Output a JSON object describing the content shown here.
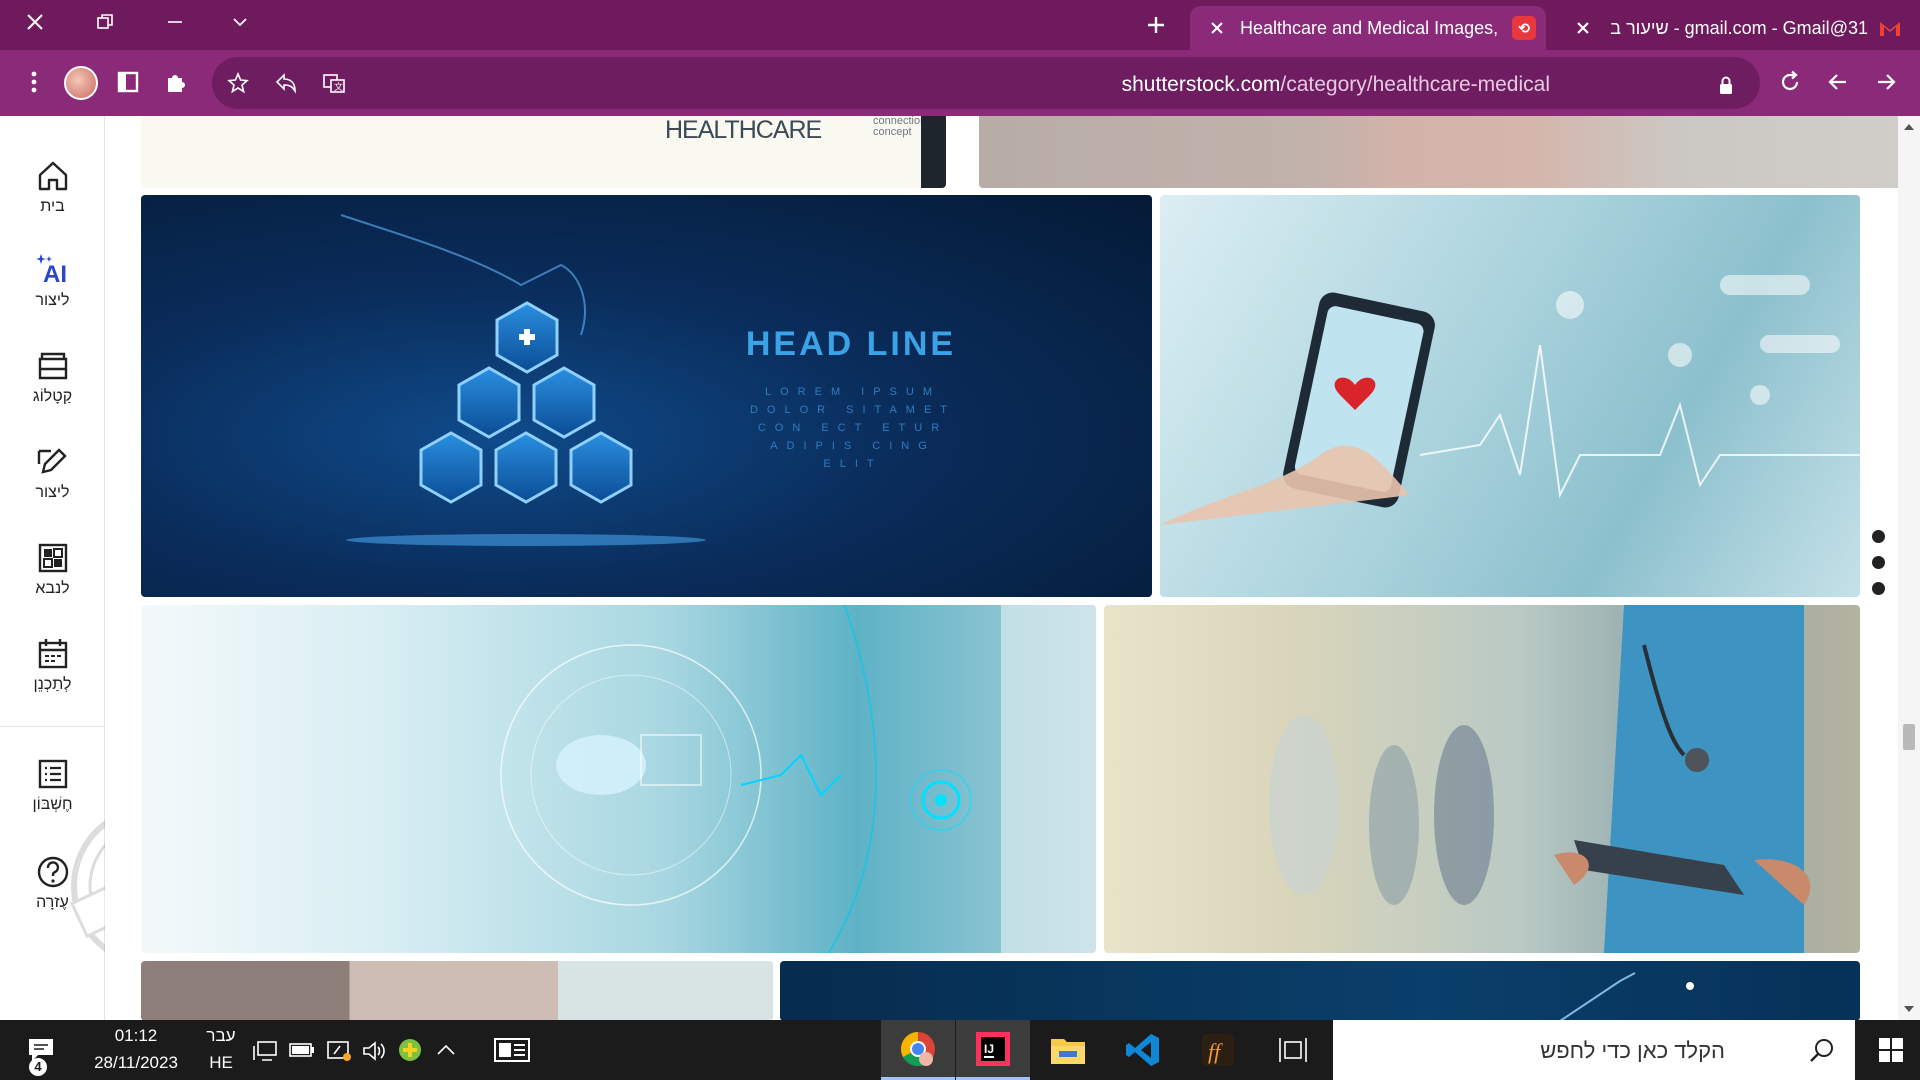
{
  "browser": {
    "tabs": [
      {
        "title": "Healthcare and Medical Images,",
        "favicon": "shutterstock-icon",
        "active": true
      },
      {
        "title": "31@gmail.com - Gmail - שיעור ב",
        "favicon": "gmail-icon",
        "active": false
      }
    ],
    "new_tab_label": "+",
    "url_host": "shutterstock.com",
    "url_path": "/category/healthcare-medical"
  },
  "rail": {
    "items": [
      {
        "label": "בית",
        "icon": "home-icon"
      },
      {
        "label": "ליצור",
        "icon": "ai-create-icon"
      },
      {
        "label": "קַטָלוֹג",
        "icon": "catalog-icon"
      },
      {
        "label": "ליצור",
        "icon": "edit-icon"
      },
      {
        "label": "לנבא",
        "icon": "predict-icon"
      },
      {
        "label": "לְתַכְנֵן",
        "icon": "calendar-icon"
      },
      {
        "label": "חֶשְׁבּוֹן",
        "icon": "account-icon"
      },
      {
        "label": "עֶזרָה",
        "icon": "help-icon"
      }
    ]
  },
  "images": {
    "top_left_caption_main": "HEALTHCARE",
    "top_left_caption_sub1": "connection",
    "top_left_caption_sub2": "concept",
    "headline_title": "HEAD LINE",
    "headline_body": [
      "LOREM IPSUM",
      "DOLOR SITAMET",
      "CON ECT ETUR",
      "ADIPIS CING",
      "ELIT"
    ]
  },
  "taskbar": {
    "notification_count": "4",
    "time": "01:12",
    "date": "28/11/2023",
    "lang_top": "עבר",
    "lang_bottom": "HE",
    "search_placeholder": "הקלד כאן כדי לחפש"
  },
  "colors": {
    "titlebar": "#6e1a5c",
    "toolbar": "#8b2a78",
    "taskbar": "#1b1b1b"
  }
}
